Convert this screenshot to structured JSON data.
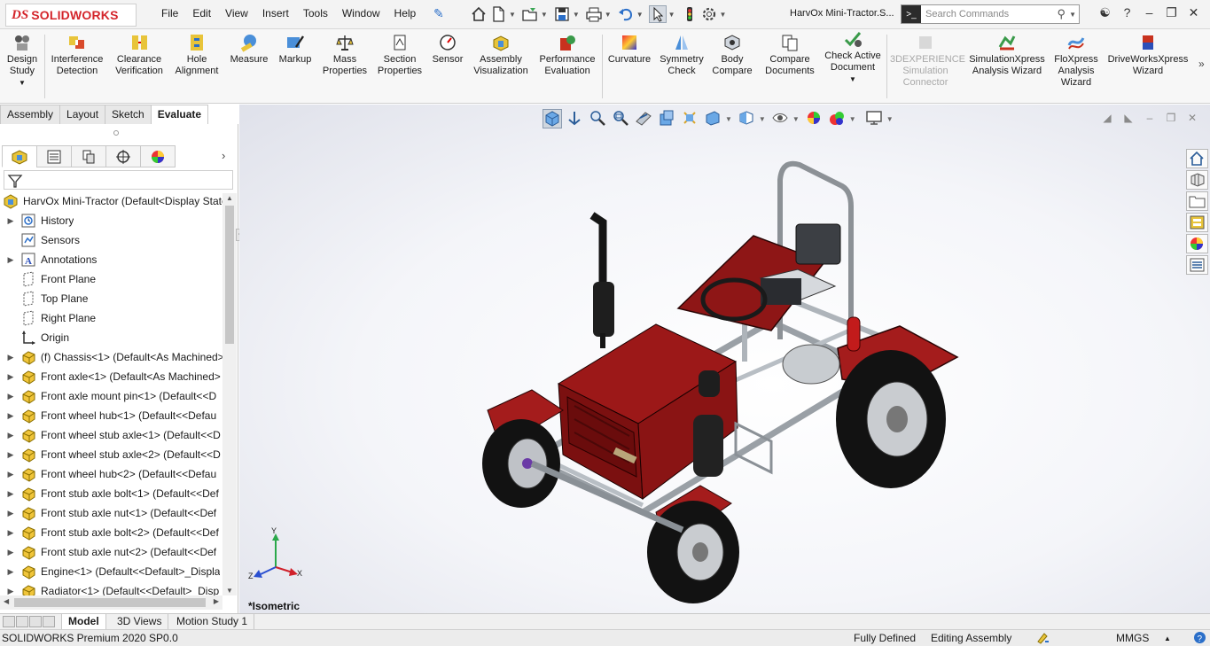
{
  "app": {
    "logo_prefix": "DS",
    "logo_text": "SOLIDWORKS",
    "document_title": "HarvOx Mini-Tractor.S...",
    "search_placeholder": "Search Commands",
    "accent_color": "#d4252b"
  },
  "menu": [
    "File",
    "Edit",
    "View",
    "Insert",
    "Tools",
    "Window",
    "Help"
  ],
  "quick_access_icons": [
    "home-icon",
    "new-document-icon",
    "open-icon",
    "save-icon",
    "print-icon",
    "undo-icon",
    "select-icon",
    "rebuild-icon",
    "options-icon"
  ],
  "window_controls": [
    "user-icon",
    "help-icon",
    "minimize-icon",
    "restore-icon",
    "close-icon"
  ],
  "commands": [
    {
      "id": "design-study",
      "label1": "Design",
      "label2": "Study",
      "icon": "design-study-icon",
      "has_dropdown": true
    },
    {
      "id": "interference-detection",
      "label1": "Interference",
      "label2": "Detection",
      "icon": "interference-icon"
    },
    {
      "id": "clearance-verification",
      "label1": "Clearance",
      "label2": "Verification",
      "icon": "clearance-icon"
    },
    {
      "id": "hole-alignment",
      "label1": "Hole",
      "label2": "Alignment",
      "icon": "hole-alignment-icon"
    },
    {
      "id": "measure",
      "label1": "Measure",
      "label2": "",
      "icon": "measure-icon"
    },
    {
      "id": "markup",
      "label1": "Markup",
      "label2": "",
      "icon": "markup-icon"
    },
    {
      "id": "mass-properties",
      "label1": "Mass",
      "label2": "Properties",
      "icon": "mass-properties-icon"
    },
    {
      "id": "section-properties",
      "label1": "Section",
      "label2": "Properties",
      "icon": "section-properties-icon"
    },
    {
      "id": "sensor",
      "label1": "Sensor",
      "label2": "",
      "icon": "sensor-icon"
    },
    {
      "id": "assembly-visualization",
      "label1": "Assembly",
      "label2": "Visualization",
      "icon": "assembly-visualization-icon"
    },
    {
      "id": "performance-evaluation",
      "label1": "Performance",
      "label2": "Evaluation",
      "icon": "performance-icon"
    },
    {
      "id": "curvature",
      "label1": "Curvature",
      "label2": "",
      "icon": "curvature-icon"
    },
    {
      "id": "symmetry-check",
      "label1": "Symmetry",
      "label2": "Check",
      "icon": "symmetry-icon"
    },
    {
      "id": "body-compare",
      "label1": "Body",
      "label2": "Compare",
      "icon": "body-compare-icon"
    },
    {
      "id": "compare-documents",
      "label1": "Compare",
      "label2": "Documents",
      "icon": "compare-documents-icon",
      "selected": true
    },
    {
      "id": "check-active-document",
      "label1": "Check Active",
      "label2": "Document",
      "icon": "check-document-icon",
      "has_dropdown": true
    },
    {
      "id": "3dexperience-connector",
      "label1": "3DEXPERIENCE",
      "label2": "Simulation",
      "label3": "Connector",
      "icon": "3dexperience-icon",
      "disabled": true
    },
    {
      "id": "simulationxpress",
      "label1": "SimulationXpress",
      "label2": "Analysis Wizard",
      "icon": "simulationxpress-icon"
    },
    {
      "id": "floxpress",
      "label1": "FloXpress",
      "label2": "Analysis",
      "label3": "Wizard",
      "icon": "floxpress-icon"
    },
    {
      "id": "driveworksxpress",
      "label1": "DriveWorksXpress",
      "label2": "Wizard",
      "icon": "driveworksxpress-icon"
    }
  ],
  "command_tabs": [
    {
      "label": "Assembly",
      "active": false
    },
    {
      "label": "Layout",
      "active": false
    },
    {
      "label": "Sketch",
      "active": false
    },
    {
      "label": "Evaluate",
      "active": true
    }
  ],
  "panel_tabs": [
    "featuremanager-icon",
    "propertymanager-icon",
    "configurationmanager-icon",
    "dimxpert-icon",
    "displaymanager-icon"
  ],
  "tree": [
    {
      "label": "HarvOx Mini-Tractor  (Default<Display State",
      "icon": "assembly-icon",
      "expander": false,
      "root": true
    },
    {
      "label": "History",
      "icon": "history-icon",
      "expander": true
    },
    {
      "label": "Sensors",
      "icon": "sensors-icon",
      "expander": false
    },
    {
      "label": "Annotations",
      "icon": "annotations-icon",
      "expander": true
    },
    {
      "label": "Front Plane",
      "icon": "plane-icon",
      "expander": false
    },
    {
      "label": "Top Plane",
      "icon": "plane-icon",
      "expander": false
    },
    {
      "label": "Right Plane",
      "icon": "plane-icon",
      "expander": false
    },
    {
      "label": "Origin",
      "icon": "origin-icon",
      "expander": false
    },
    {
      "label": "(f) Chassis<1> (Default<As Machined>",
      "icon": "part-icon",
      "expander": true
    },
    {
      "label": "Front axle<1> (Default<As Machined>",
      "icon": "part-icon",
      "expander": true
    },
    {
      "label": "Front axle mount pin<1> (Default<<D",
      "icon": "part-icon",
      "expander": true
    },
    {
      "label": "Front wheel hub<1> (Default<<Defau",
      "icon": "part-icon",
      "expander": true
    },
    {
      "label": "Front wheel stub axle<1> (Default<<D",
      "icon": "part-icon",
      "expander": true
    },
    {
      "label": "Front wheel stub axle<2> (Default<<D",
      "icon": "part-icon",
      "expander": true
    },
    {
      "label": "Front wheel hub<2> (Default<<Defau",
      "icon": "part-icon",
      "expander": true
    },
    {
      "label": "Front stub axle bolt<1> (Default<<Def",
      "icon": "part-icon",
      "expander": true
    },
    {
      "label": "Front stub axle nut<1> (Default<<Def",
      "icon": "part-icon",
      "expander": true
    },
    {
      "label": "Front stub axle bolt<2> (Default<<Def",
      "icon": "part-icon",
      "expander": true
    },
    {
      "label": "Front stub axle nut<2> (Default<<Def",
      "icon": "part-icon",
      "expander": true
    },
    {
      "label": "Engine<1> (Default<<Default>_Displa",
      "icon": "part-icon",
      "expander": true
    },
    {
      "label": "Radiator<1> (Default<<Default>_Disp",
      "icon": "part-icon",
      "expander": true
    }
  ],
  "headsup_toolbar": [
    "view-orientation-icon",
    "zoom-to-fit-icon",
    "zoom-to-area-icon",
    "previous-view-icon",
    "section-view-icon",
    "dynamic-annotation-icon",
    "view-selector-icon",
    "display-style-icon",
    "hide-show-icon",
    "edit-appearance-icon",
    "apply-scene-icon",
    "view-settings-icon"
  ],
  "task_pane": [
    "resources-icon",
    "design-library-icon",
    "file-explorer-icon",
    "view-palette-icon",
    "appearances-icon",
    "custom-properties-icon"
  ],
  "viewport": {
    "view_label": "*Isometric",
    "triad_x": "X",
    "triad_y": "Y",
    "triad_z": "Z"
  },
  "bottom_tabs": [
    {
      "label": "Model",
      "active": true
    },
    {
      "label": "3D Views",
      "active": false
    },
    {
      "label": "Motion Study 1",
      "active": false
    }
  ],
  "status": {
    "product": "SOLIDWORKS Premium 2020 SP0.0",
    "state": "Fully Defined",
    "mode": "Editing Assembly",
    "units": "MMGS"
  }
}
